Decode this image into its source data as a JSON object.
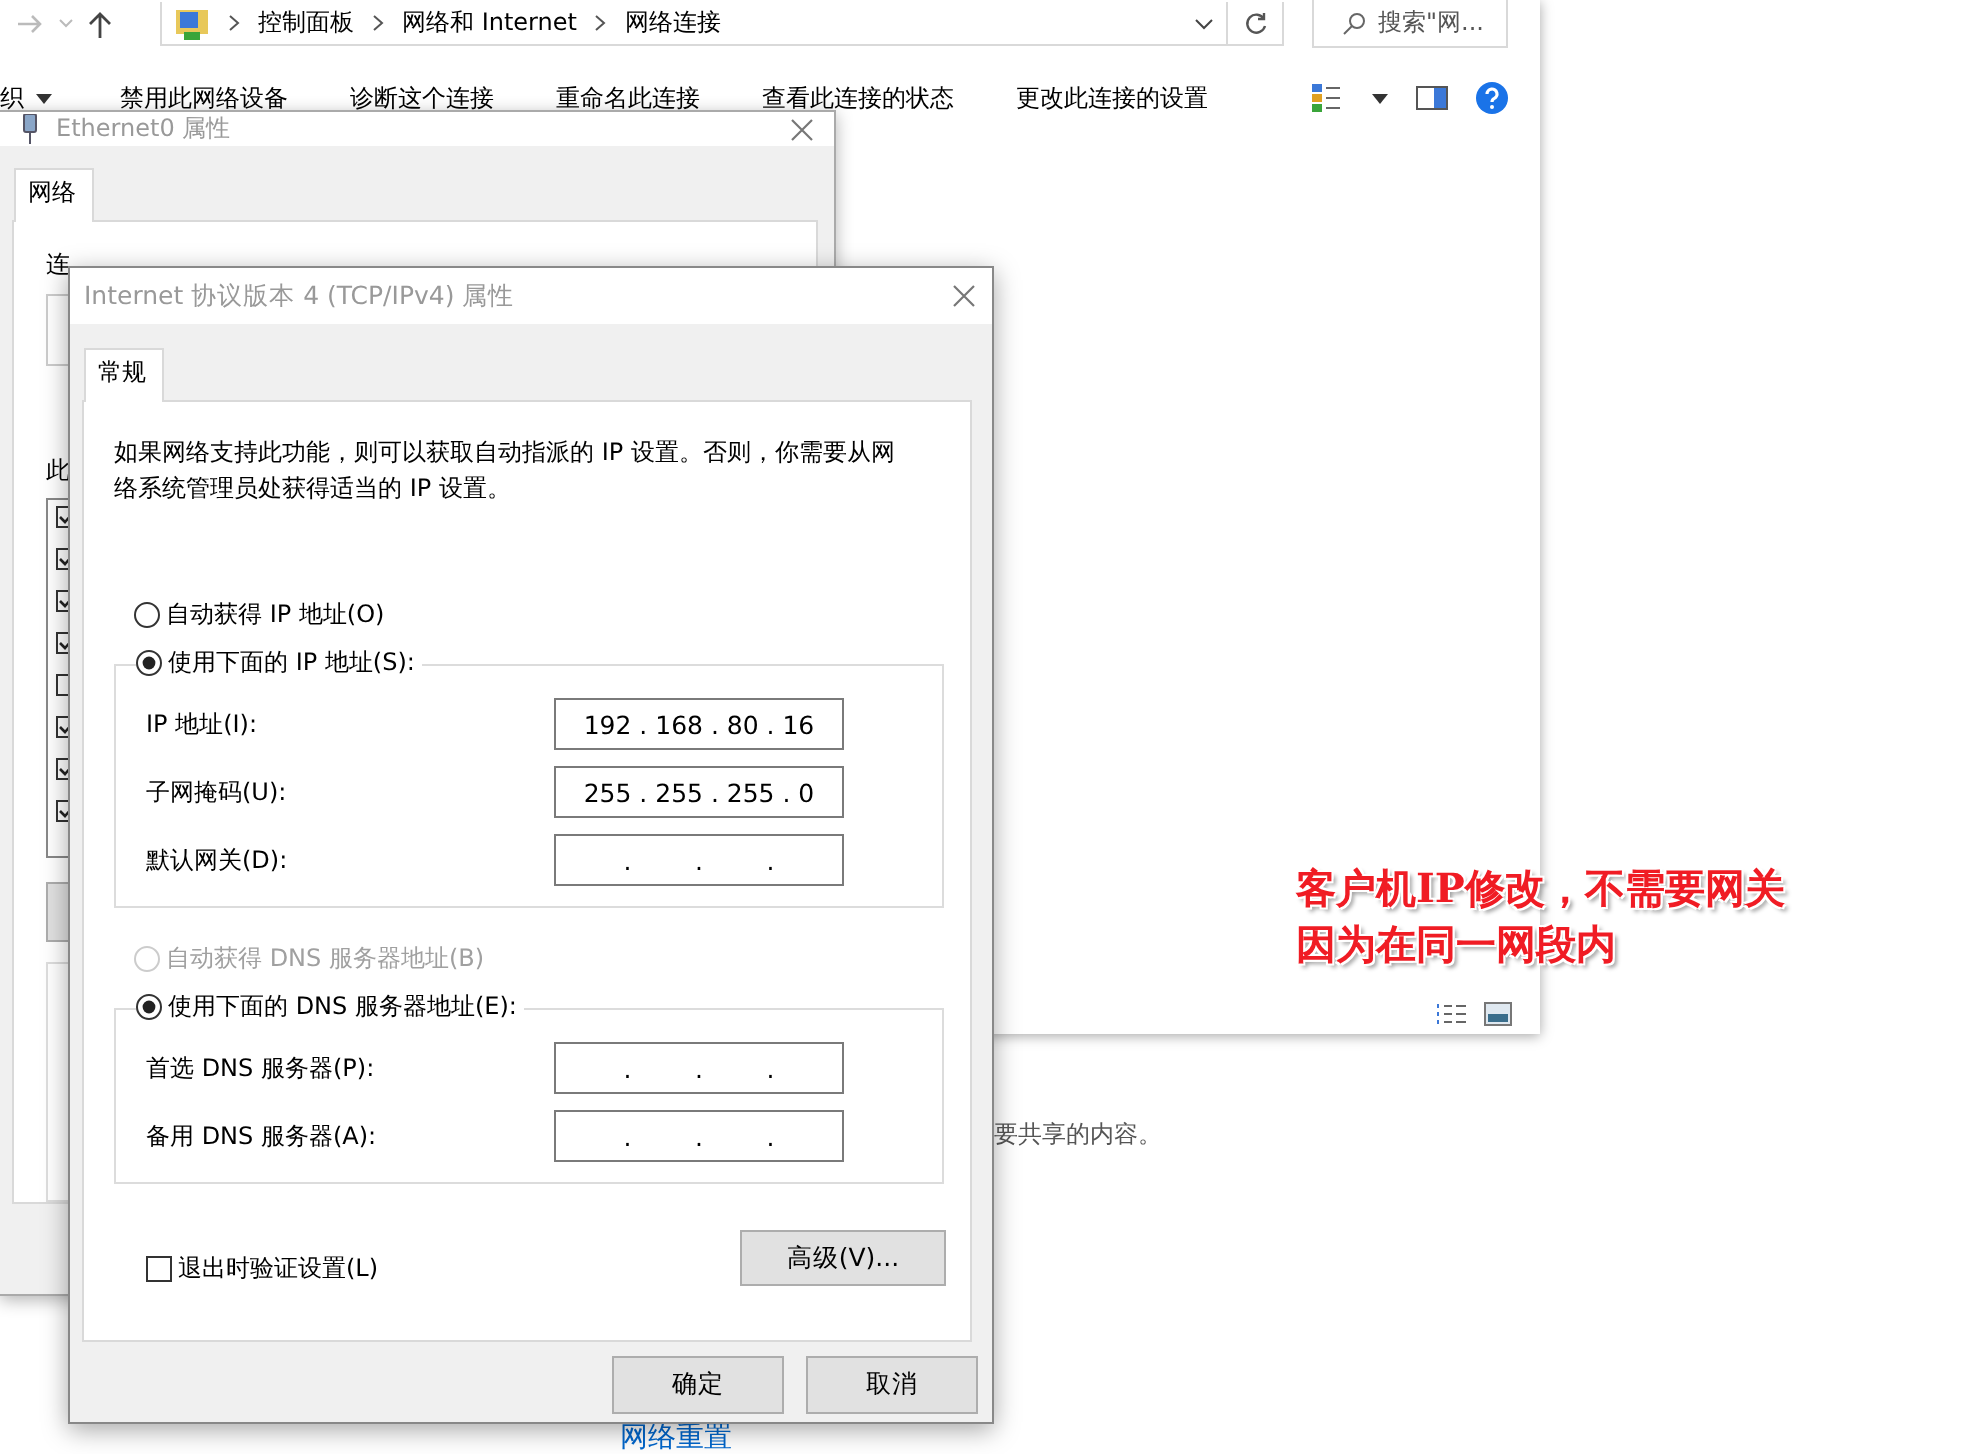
{
  "explorer": {
    "breadcrumbs": [
      "控制面板",
      "网络和 Internet",
      "网络连接"
    ],
    "search": {
      "placeholder": "搜索\"网..."
    },
    "toolbar": [
      {
        "label": "织",
        "kind": "menu"
      },
      {
        "label": "禁用此网络设备",
        "kind": "command"
      },
      {
        "label": "诊断这个连接",
        "kind": "command"
      },
      {
        "label": "重命名此连接",
        "kind": "command"
      },
      {
        "label": "查看此连接的状态",
        "kind": "command"
      },
      {
        "label": "更改此连接的设置",
        "kind": "command"
      }
    ]
  },
  "settings_page": {
    "text": "要共享的内容。",
    "link": "网络重置"
  },
  "ethernet_dialog": {
    "title": "Ethernet0 属性",
    "tabs": [
      {
        "label": "网络",
        "selected": true
      }
    ],
    "label_1": "连",
    "label_2": "此",
    "components": [
      {
        "checked": true
      },
      {
        "checked": true
      },
      {
        "checked": true
      },
      {
        "checked": true
      },
      {
        "checked": false
      },
      {
        "checked": true
      },
      {
        "checked": true
      },
      {
        "checked": true
      }
    ]
  },
  "ipv4_dialog": {
    "title": "Internet 协议版本 4 (TCP/IPv4) 属性",
    "tabs": [
      {
        "label": "常规",
        "selected": true
      }
    ],
    "description": "如果网络支持此功能，则可以获取自动指派的 IP 设置。否则，你需要从网络系统管理员处获得适当的 IP 设置。",
    "ip_options": [
      {
        "label": "自动获得 IP 地址(O)",
        "selected": false,
        "disabled": false
      },
      {
        "label": "使用下面的 IP 地址(S):",
        "selected": true,
        "disabled": false
      }
    ],
    "ip_fields": [
      {
        "label": "IP 地址(I):",
        "value": "192 . 168 . 80 . 16"
      },
      {
        "label": "子网掩码(U):",
        "value": "255 . 255 . 255 . 0"
      },
      {
        "label": "默认网关(D):",
        "value": ".        .        ."
      }
    ],
    "dns_options": [
      {
        "label": "自动获得 DNS 服务器地址(B)",
        "selected": false,
        "disabled": true
      },
      {
        "label": "使用下面的 DNS 服务器地址(E):",
        "selected": true,
        "disabled": false
      }
    ],
    "dns_fields": [
      {
        "label": "首选 DNS 服务器(P):",
        "value": ".        .        ."
      },
      {
        "label": "备用 DNS 服务器(A):",
        "value": ".        .        ."
      }
    ],
    "validate_checkbox": {
      "label": "退出时验证设置(L)",
      "checked": false
    },
    "advanced_button": "高级(V)...",
    "buttons": [
      "确定",
      "取消"
    ]
  },
  "annotation": [
    "客户机IP修改，不需要网关",
    "因为在同一网段内"
  ]
}
